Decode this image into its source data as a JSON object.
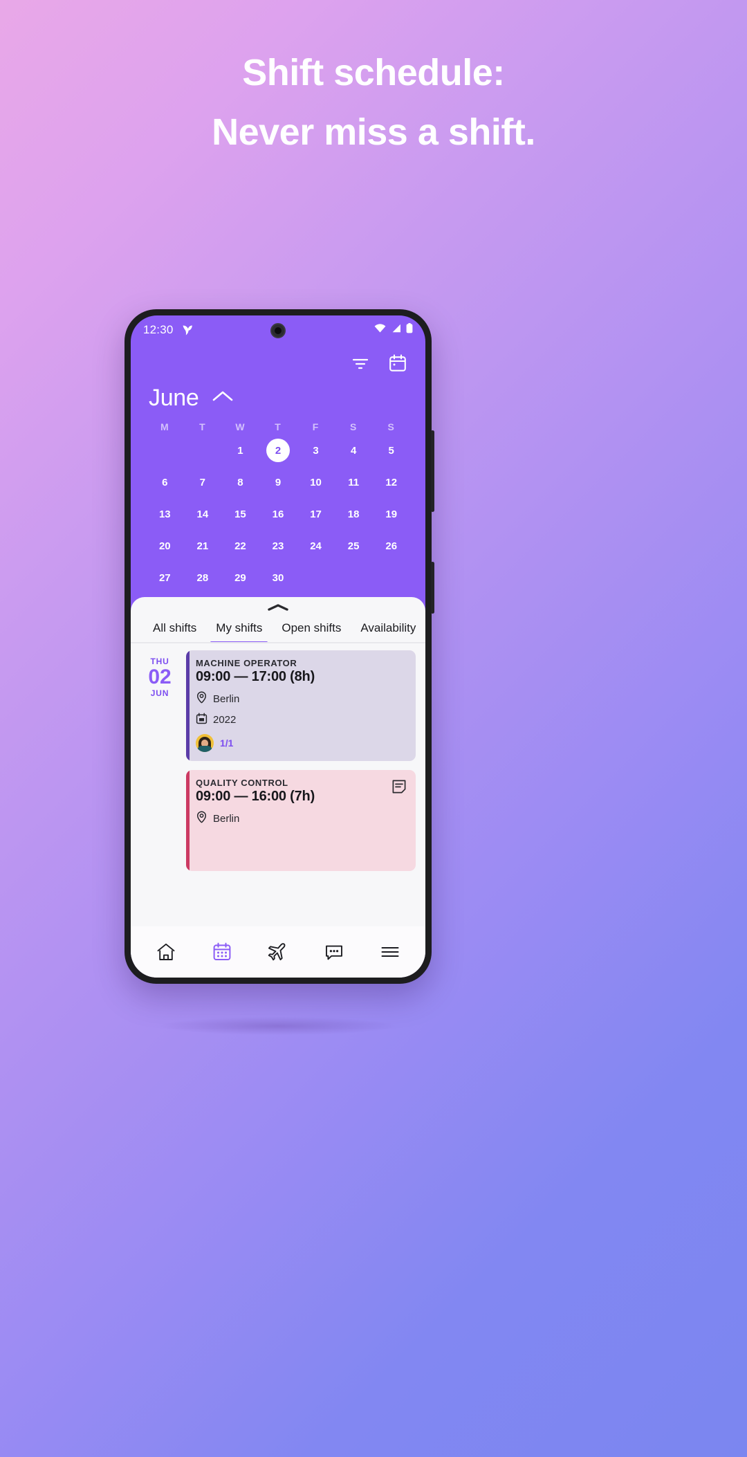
{
  "promo": {
    "line1": "Shift schedule:",
    "line2": "Never miss a shift."
  },
  "status_bar": {
    "time": "12:30",
    "app_logo_icon": "bird-logo-icon",
    "wifi_icon": "wifi-icon",
    "signal_icon": "cellular-signal-icon",
    "battery_icon": "battery-full-icon"
  },
  "header": {
    "filter_icon": "filter-icon",
    "calendar_icon": "calendar-icon",
    "month": "June",
    "collapse_icon": "chevron-up-icon"
  },
  "calendar": {
    "weekdays": [
      "M",
      "T",
      "W",
      "T",
      "F",
      "S",
      "S"
    ],
    "selected_day": "2",
    "weeks": [
      [
        "",
        "",
        "1",
        "2",
        "3",
        "4",
        "5"
      ],
      [
        "6",
        "7",
        "8",
        "9",
        "10",
        "11",
        "12"
      ],
      [
        "13",
        "14",
        "15",
        "16",
        "17",
        "18",
        "19"
      ],
      [
        "20",
        "21",
        "22",
        "23",
        "24",
        "25",
        "26"
      ],
      [
        "27",
        "28",
        "29",
        "30",
        "",
        "",
        ""
      ]
    ]
  },
  "sheet": {
    "grabber_icon": "drag-handle-icon",
    "tabs": [
      {
        "label": "All shifts",
        "active": false
      },
      {
        "label": "My shifts",
        "active": true
      },
      {
        "label": "Open shifts",
        "active": false
      },
      {
        "label": "Availability",
        "active": false
      }
    ],
    "shifts": [
      {
        "date_dow": "THU",
        "date_num": "02",
        "date_mon": "JUN",
        "title": "MACHINE OPERATOR",
        "time": "09:00  — 17:00 (8h)",
        "location_icon": "location-pin-icon",
        "location": "Berlin",
        "group_icon": "calendar-small-icon",
        "group": "2022",
        "avatar_icon": "user-avatar",
        "staffing": "1/1",
        "accent": "#5b3ca8",
        "background": "#dcd7e8"
      },
      {
        "title": "QUALITY CONTROL",
        "time": "09:00  — 16:00 (7h)",
        "location_icon": "location-pin-icon",
        "location": "Berlin",
        "note_icon": "note-icon",
        "accent": "#cc3a63",
        "background": "#f6d9e1"
      }
    ]
  },
  "bottom_nav": [
    {
      "icon": "home-icon",
      "active": false
    },
    {
      "icon": "calendar-icon",
      "active": true
    },
    {
      "icon": "airplane-icon",
      "active": false
    },
    {
      "icon": "chat-bubble-icon",
      "active": false
    },
    {
      "icon": "menu-icon",
      "active": false
    }
  ],
  "theme": {
    "purple": "#8b5cf6",
    "accent_dark": "#7c4df0",
    "sheet_bg": "#f7f7f9"
  }
}
